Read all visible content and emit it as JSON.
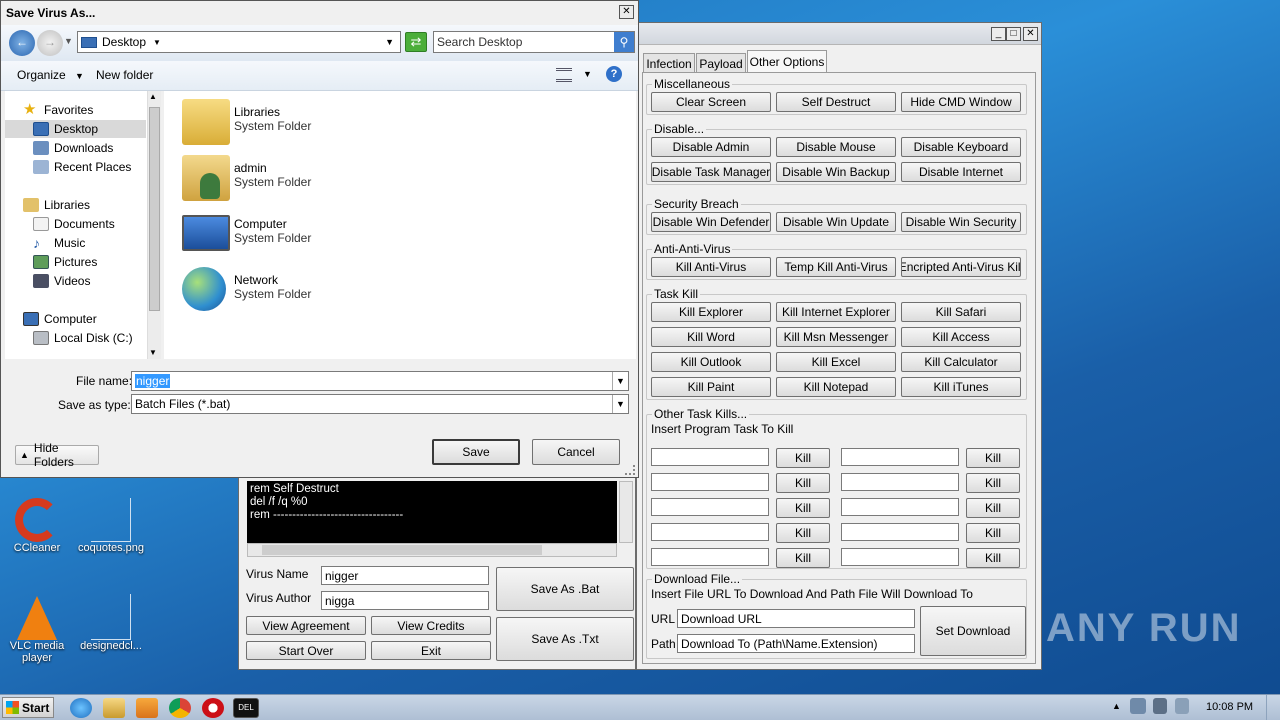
{
  "dialog": {
    "title": "Save Virus As...",
    "location": "Desktop",
    "search_placeholder": "Search Desktop",
    "toolbar": {
      "organize": "Organize",
      "new_folder": "New folder"
    },
    "nav": {
      "favorites": "Favorites",
      "desktop": "Desktop",
      "downloads": "Downloads",
      "recent_places": "Recent Places",
      "libraries": "Libraries",
      "documents": "Documents",
      "music": "Music",
      "pictures": "Pictures",
      "videos": "Videos",
      "computer": "Computer",
      "local_disk": "Local Disk (C:)"
    },
    "files": [
      {
        "name": "Libraries",
        "type": "System Folder"
      },
      {
        "name": "admin",
        "type": "System Folder"
      },
      {
        "name": "Computer",
        "type": "System Folder"
      },
      {
        "name": "Network",
        "type": "System Folder"
      }
    ],
    "file_name_label": "File name:",
    "file_name_value": "nigger",
    "save_type_label": "Save as type:",
    "save_type_value": "Batch Files (*.bat)",
    "hide_folders": "Hide Folders",
    "save": "Save",
    "cancel": "Cancel"
  },
  "maker": {
    "tabs": [
      "Infection",
      "Payload",
      "Other Options"
    ],
    "miscellaneous": {
      "title": "Miscellaneous",
      "buttons": [
        "Clear Screen",
        "Self Destruct",
        "Hide CMD Window"
      ]
    },
    "disable": {
      "title": "Disable...",
      "buttons": [
        "Disable Admin",
        "Disable Mouse",
        "Disable Keyboard",
        "Disable Task Manager",
        "Disable Win Backup",
        "Disable Internet"
      ]
    },
    "security": {
      "title": "Security Breach",
      "buttons": [
        "Disable Win Defender",
        "Disable Win Update",
        "Disable Win Security"
      ]
    },
    "antiav": {
      "title": "Anti-Anti-Virus",
      "buttons": [
        "Kill Anti-Virus",
        "Temp Kill Anti-Virus",
        "Encripted Anti-Virus Kill"
      ]
    },
    "taskkill": {
      "title": "Task Kill",
      "buttons": [
        "Kill Explorer",
        "Kill Internet Explorer",
        "Kill Safari",
        "Kill Word",
        "Kill Msn Messenger",
        "Kill Access",
        "Kill Outlook",
        "Kill Excel",
        "Kill Calculator",
        "Kill Paint",
        "Kill Notepad",
        "Kill iTunes"
      ]
    },
    "other_kills": {
      "title": "Other Task Kills...",
      "instruction": "Insert Program Task To Kill",
      "kill_label": "Kill"
    },
    "download": {
      "title": "Download File...",
      "instruction": "Insert File URL To Download And Path File Will Download To",
      "url_label": "URL",
      "url_value": "Download URL",
      "path_label": "Path",
      "path_value": "Download To (Path\\Name.Extension)",
      "set_button": "Set Download"
    }
  },
  "console": {
    "lines": [
      "rem Self Destruct",
      "del /f /q %0",
      "rem ----------------------------------"
    ],
    "virus_name_label": "Virus Name",
    "virus_name_value": "nigger",
    "virus_author_label": "Virus Author",
    "virus_author_value": "nigga",
    "view_agreement": "View Agreement",
    "view_credits": "View Credits",
    "start_over": "Start Over",
    "exit": "Exit",
    "save_bat": "Save As .Bat",
    "save_txt": "Save As .Txt"
  },
  "desktop": {
    "icons": [
      "CCleaner",
      "coquotes.png",
      "VLC media player",
      "designedcl..."
    ],
    "watermark": "ANY RUN"
  },
  "taskbar": {
    "start": "Start",
    "clock": "10:08 PM"
  },
  "colors": {
    "desktop_blue": "#1d6fb8",
    "selection": "#3399ff",
    "taskbar": "#c9d6e6"
  }
}
